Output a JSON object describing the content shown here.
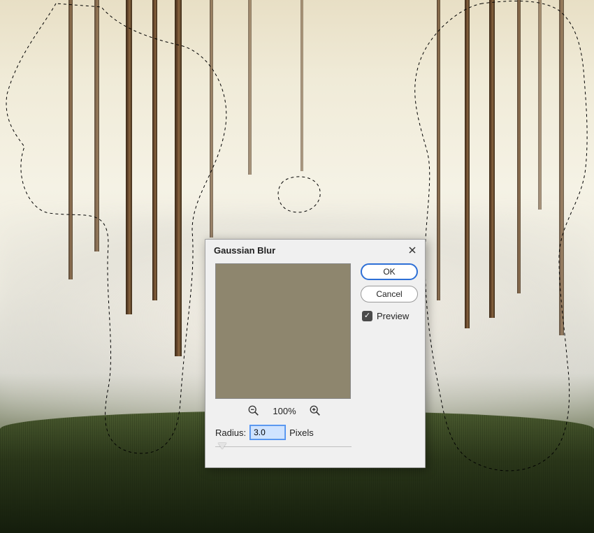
{
  "dialog": {
    "title": "Gaussian Blur",
    "ok": "OK",
    "cancel": "Cancel",
    "preview_label": "Preview",
    "preview_checked": "✓",
    "zoom_level": "100%",
    "radius_label": "Radius:",
    "radius_value": "3.0",
    "radius_units": "Pixels"
  }
}
